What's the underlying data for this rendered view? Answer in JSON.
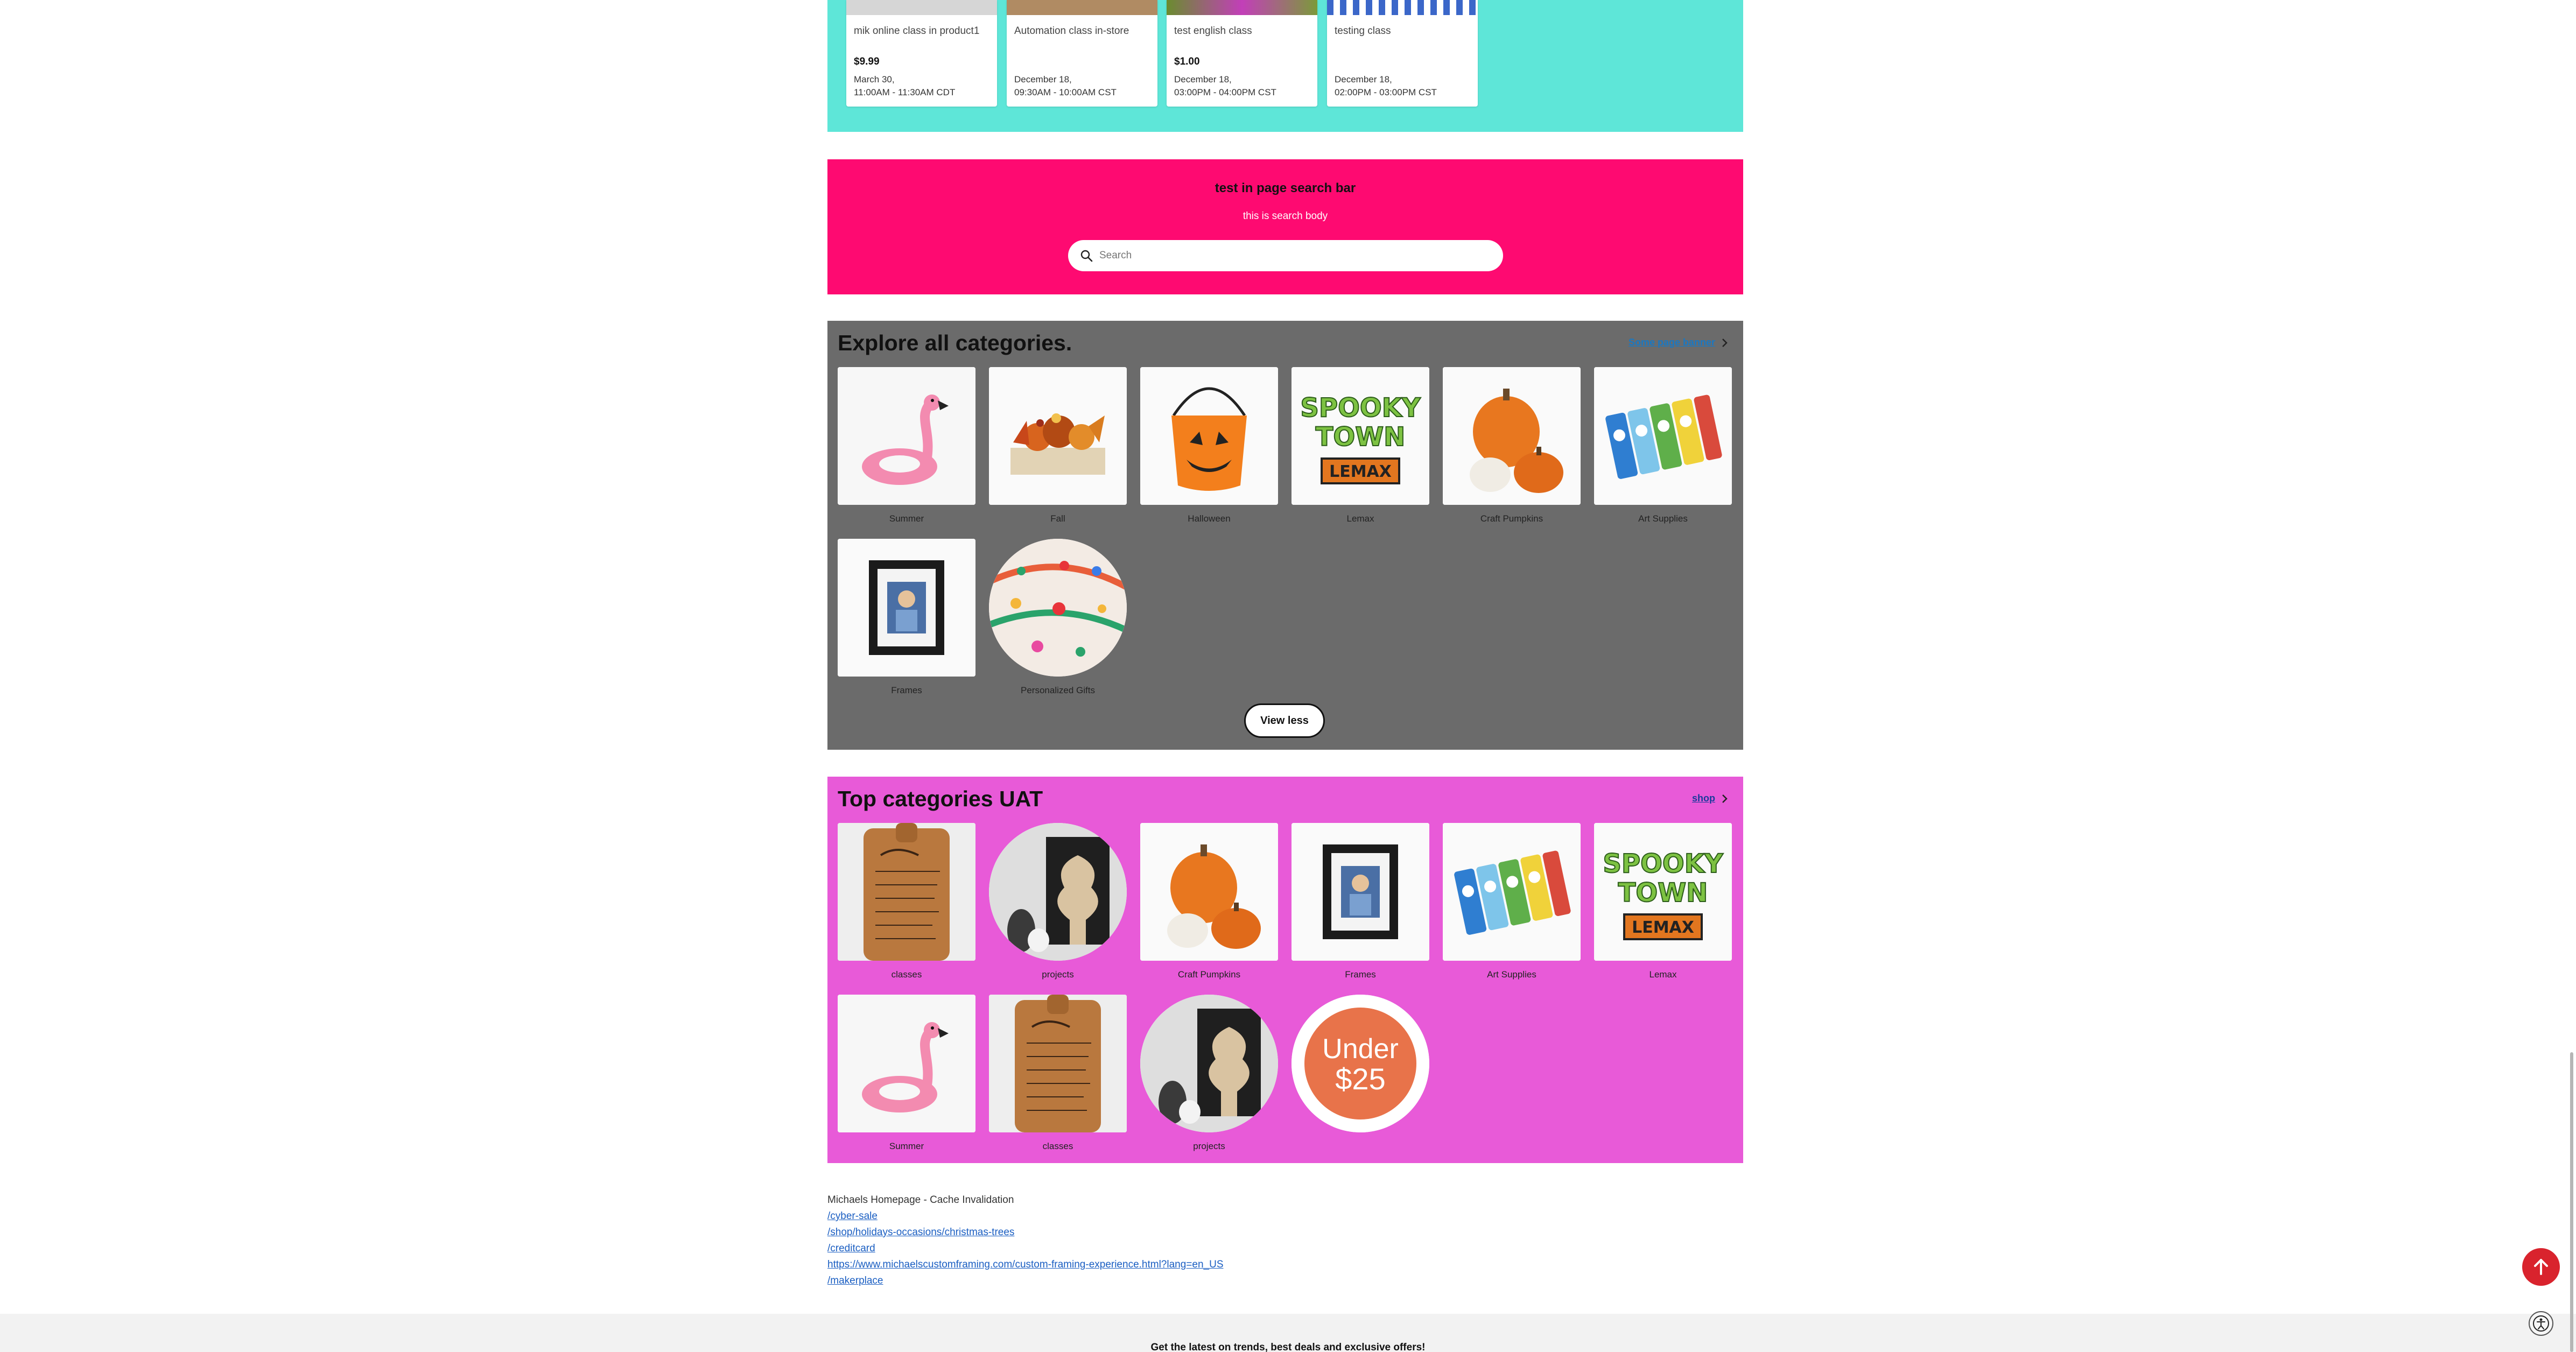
{
  "classes": [
    {
      "title": "mik online class in product1",
      "price": "$9.99",
      "date": "March 30,",
      "time": "11:00AM - 11:30AM CDT",
      "thumb_color": "#d6d6d6"
    },
    {
      "title": "Automation class in-store",
      "price": "",
      "date": "December 18,",
      "time": "09:30AM - 10:00AM CST",
      "thumb_color": "#b08b63"
    },
    {
      "title": "test english class",
      "price": "$1.00",
      "date": "December 18,",
      "time": "03:00PM - 04:00PM CST",
      "thumb_color": "#7b9a3a"
    },
    {
      "title": "testing class",
      "price": "",
      "date": "December 18,",
      "time": "02:00PM - 03:00PM CST",
      "thumb_color": "#3b67c9"
    }
  ],
  "search_section": {
    "title": "test in page search bar",
    "body": "this is search body",
    "placeholder": "Search",
    "bg_color": "#fe0a71"
  },
  "explore": {
    "title": "Explore all categories.",
    "link": "Some page banner",
    "button": "View less",
    "bg_color": "#6b6b6b",
    "items": [
      {
        "label": "Summer",
        "icon": "flamingo-float"
      },
      {
        "label": "Fall",
        "icon": "fall-centerpiece"
      },
      {
        "label": "Halloween",
        "icon": "pumpkin-bucket"
      },
      {
        "label": "Lemax",
        "icon": "spooky-town-logo"
      },
      {
        "label": "Craft Pumpkins",
        "icon": "craft-pumpkins"
      },
      {
        "label": "Art Supplies",
        "icon": "paint-tubes"
      },
      {
        "label": "Frames",
        "icon": "photo-frame"
      },
      {
        "label": "Personalized Gifts",
        "icon": "personalized-plate"
      }
    ],
    "spooky": {
      "line1": "SPOOKY",
      "line2": "TOWN",
      "badge": "LEMAX"
    }
  },
  "topcat": {
    "title": "Top categories UAT",
    "link": "shop",
    "bg_color": "#e85ad8",
    "items": [
      {
        "label": "classes",
        "icon": "cutting-board"
      },
      {
        "label": "projects",
        "icon": "tree-sign"
      },
      {
        "label": "Craft Pumpkins",
        "icon": "craft-pumpkins"
      },
      {
        "label": "Frames",
        "icon": "photo-frame"
      },
      {
        "label": "Art Supplies",
        "icon": "paint-tubes"
      },
      {
        "label": "Lemax",
        "icon": "spooky-town-logo"
      },
      {
        "label": "Summer",
        "icon": "flamingo-float"
      },
      {
        "label": "classes",
        "icon": "cutting-board"
      },
      {
        "label": "projects",
        "icon": "tree-sign"
      },
      {
        "label": "",
        "icon": "under-25-badge"
      }
    ],
    "under25": {
      "line1": "Under",
      "line2": "$25"
    }
  },
  "footer_links": {
    "caption": "Michaels Homepage - Cache Invalidation",
    "links": [
      "/cyber-sale",
      "/shop/holidays-occasions/christmas-trees",
      "/creditcard",
      "https://www.michaelscustomframing.com/custom-framing-experience.html?lang=en_US",
      "/makerplace"
    ]
  },
  "newsletter": "Get the latest on trends, best deals and exclusive offers!",
  "colors": {
    "accent_red": "#d9232d",
    "link_blue": "#1a5ec2",
    "teal": "#5ee6d8"
  }
}
